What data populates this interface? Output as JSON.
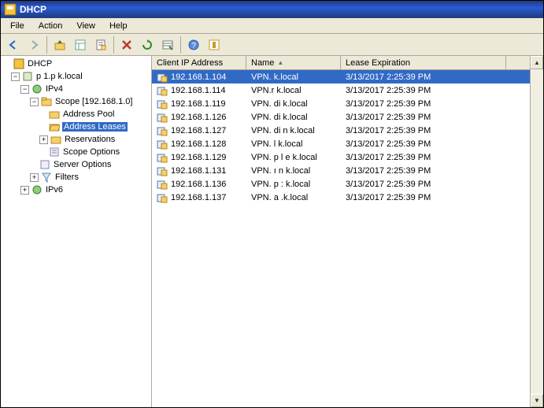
{
  "window": {
    "title": "DHCP"
  },
  "menus": [
    "File",
    "Action",
    "View",
    "Help"
  ],
  "toolbar_icons": [
    "back-icon",
    "forward-icon",
    "up-icon",
    "show-hide-tree-icon",
    "properties-icon",
    "delete-icon",
    "refresh-icon",
    "export-list-icon",
    "sep",
    "help-icon",
    "action-icon"
  ],
  "tree": {
    "root": "DHCP",
    "server": "p        1.p       k.local",
    "ipv4": "IPv4",
    "scope": "Scope [192.168.1.0]",
    "address_pool": "Address Pool",
    "address_leases": "Address Leases",
    "reservations": "Reservations",
    "scope_options": "Scope Options",
    "server_options": "Server Options",
    "filters": "Filters",
    "ipv6": "IPv6"
  },
  "columns": {
    "ip": "Client IP Address",
    "name": "Name",
    "lease": "Lease Expiration"
  },
  "col_widths": {
    "ip": 120,
    "name": 120,
    "lease": 210
  },
  "rows": [
    {
      "ip": "192.168.1.104",
      "name": "VPN.            k.local",
      "lease": "3/13/2017 2:25:39 PM",
      "selected": true
    },
    {
      "ip": "192.168.1.114",
      "name": "VPN.r         k.local",
      "lease": "3/13/2017 2:25:39 PM"
    },
    {
      "ip": "192.168.1.119",
      "name": "VPN.   di     k.local",
      "lease": "3/13/2017 2:25:39 PM"
    },
    {
      "ip": "192.168.1.126",
      "name": "VPN.   di     k.local",
      "lease": "3/13/2017 2:25:39 PM"
    },
    {
      "ip": "192.168.1.127",
      "name": "VPN.   di  n  k.local",
      "lease": "3/13/2017 2:25:39 PM"
    },
    {
      "ip": "192.168.1.128",
      "name": "VPN.   l      k.local",
      "lease": "3/13/2017 2:25:39 PM"
    },
    {
      "ip": "192.168.1.129",
      "name": "VPN. p l  e   k.local",
      "lease": "3/13/2017 2:25:39 PM"
    },
    {
      "ip": "192.168.1.131",
      "name": "VPN.   ı  n   k.local",
      "lease": "3/13/2017 2:25:39 PM"
    },
    {
      "ip": "192.168.1.136",
      "name": "VPN. p    :   k.local",
      "lease": "3/13/2017 2:25:39 PM"
    },
    {
      "ip": "192.168.1.137",
      "name": "VPN.      a  .k.local",
      "lease": "3/13/2017 2:25:39 PM"
    }
  ]
}
